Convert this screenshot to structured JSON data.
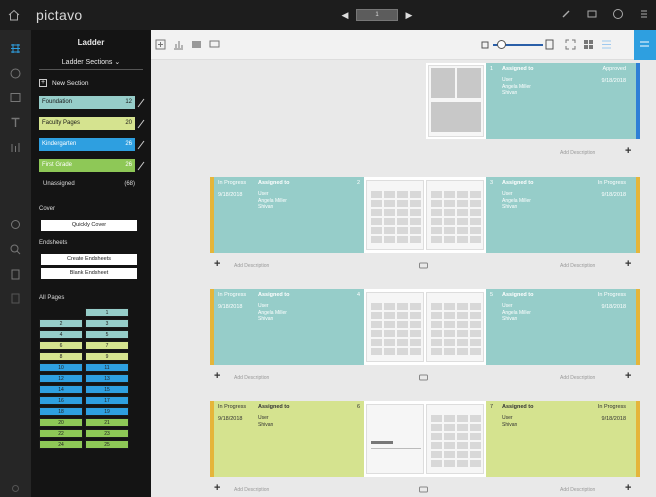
{
  "app": {
    "brand": "pictavo",
    "page_box": "1"
  },
  "panel": {
    "title": "Ladder",
    "section_select": "Ladder Sections",
    "new_section": "New Section",
    "sections": [
      {
        "label": "Foundation",
        "count": "12",
        "color": "#96cdc9"
      },
      {
        "label": "Faculty Pages",
        "count": "20",
        "color": "#d5e38f"
      },
      {
        "label": "Kindergarten",
        "count": "26",
        "color": "#2e9fe0"
      },
      {
        "label": "First Grade",
        "count": "26",
        "color": "#8ec857"
      }
    ],
    "unassigned_label": "Unassigned",
    "unassigned_count": "(68)",
    "cover_label": "Cover",
    "cover_button": "Quickly Cover",
    "endsheets_label": "Endsheets",
    "endsheets_buttons": [
      "Create Endsheets",
      "Blank Endsheet"
    ],
    "all_pages_label": "All Pages",
    "grid_rows": [
      {
        "l": "",
        "r": "1",
        "color": "#96cdc9",
        "lcolor": ""
      },
      {
        "l": "2",
        "r": "3",
        "color": "#96cdc9",
        "lcolor": "#96cdc9"
      },
      {
        "l": "4",
        "r": "5",
        "color": "#96cdc9",
        "lcolor": "#96cdc9"
      },
      {
        "l": "6",
        "r": "7",
        "color": "#d5e38f",
        "lcolor": "#d5e38f"
      },
      {
        "l": "8",
        "r": "9",
        "color": "#d5e38f",
        "lcolor": "#d5e38f"
      },
      {
        "l": "10",
        "r": "11",
        "color": "#2e9fe0",
        "lcolor": "#2e9fe0"
      },
      {
        "l": "12",
        "r": "13",
        "color": "#2e9fe0",
        "lcolor": "#2e9fe0"
      },
      {
        "l": "14",
        "r": "15",
        "color": "#2e9fe0",
        "lcolor": "#2e9fe0"
      },
      {
        "l": "16",
        "r": "17",
        "color": "#2e9fe0",
        "lcolor": "#2e9fe0"
      },
      {
        "l": "18",
        "r": "19",
        "color": "#2e9fe0",
        "lcolor": "#2e9fe0"
      },
      {
        "l": "20",
        "r": "21",
        "color": "#8ec857",
        "lcolor": "#8ec857"
      },
      {
        "l": "22",
        "r": "23",
        "color": "#8ec857",
        "lcolor": "#8ec857"
      },
      {
        "l": "24",
        "r": "25",
        "color": "#8ec857",
        "lcolor": "#8ec857"
      }
    ]
  },
  "spreads": [
    {
      "left": null,
      "right": {
        "num": "1",
        "assigned": "Assigned to",
        "users": [
          "User",
          "Angela Miller",
          "Shivan"
        ],
        "status": "Approved",
        "date": "9/18/2018",
        "color": "#96cdc9",
        "stripe": "#2e7fd6"
      },
      "add_left": "",
      "add_right": "Add Description"
    },
    {
      "left": {
        "num": "2",
        "status": "In Progress",
        "date": "9/18/2018",
        "assigned": "Assigned to",
        "users": [
          "User",
          "Angela Miller",
          "Shivan"
        ],
        "color": "#96cdc9",
        "stripe": "#e5b53a"
      },
      "right": {
        "num": "3",
        "assigned": "Assigned to",
        "users": [
          "User",
          "Angela Miller",
          "Shivan"
        ],
        "status": "In Progress",
        "date": "9/18/2018",
        "color": "#96cdc9",
        "stripe": "#e5b53a"
      },
      "add_left": "Add Description",
      "add_right": "Add Description"
    },
    {
      "left": {
        "num": "4",
        "status": "In Progress",
        "date": "9/18/2018",
        "assigned": "Assigned to",
        "users": [
          "User",
          "Angela Miller",
          "Shivan"
        ],
        "color": "#96cdc9",
        "stripe": "#e5b53a"
      },
      "right": {
        "num": "5",
        "assigned": "Assigned to",
        "users": [
          "User",
          "Angela Miller",
          "Shivan"
        ],
        "status": "In Progress",
        "date": "9/18/2018",
        "color": "#96cdc9",
        "stripe": "#e5b53a"
      },
      "add_left": "Add Description",
      "add_right": "Add Description"
    },
    {
      "left": {
        "num": "6",
        "status": "In Progress",
        "date": "9/18/2018",
        "assigned": "Assigned to",
        "users": [
          "User",
          "Shivan"
        ],
        "color": "#d5e38f",
        "stripe": "#e5b53a"
      },
      "right": {
        "num": "7",
        "assigned": "Assigned to",
        "users": [
          "User",
          "Shivan"
        ],
        "status": "In Progress",
        "date": "9/18/2018",
        "color": "#d5e38f",
        "stripe": "#e5b53a"
      },
      "add_left": "Add Description",
      "add_right": "Add Description"
    }
  ]
}
